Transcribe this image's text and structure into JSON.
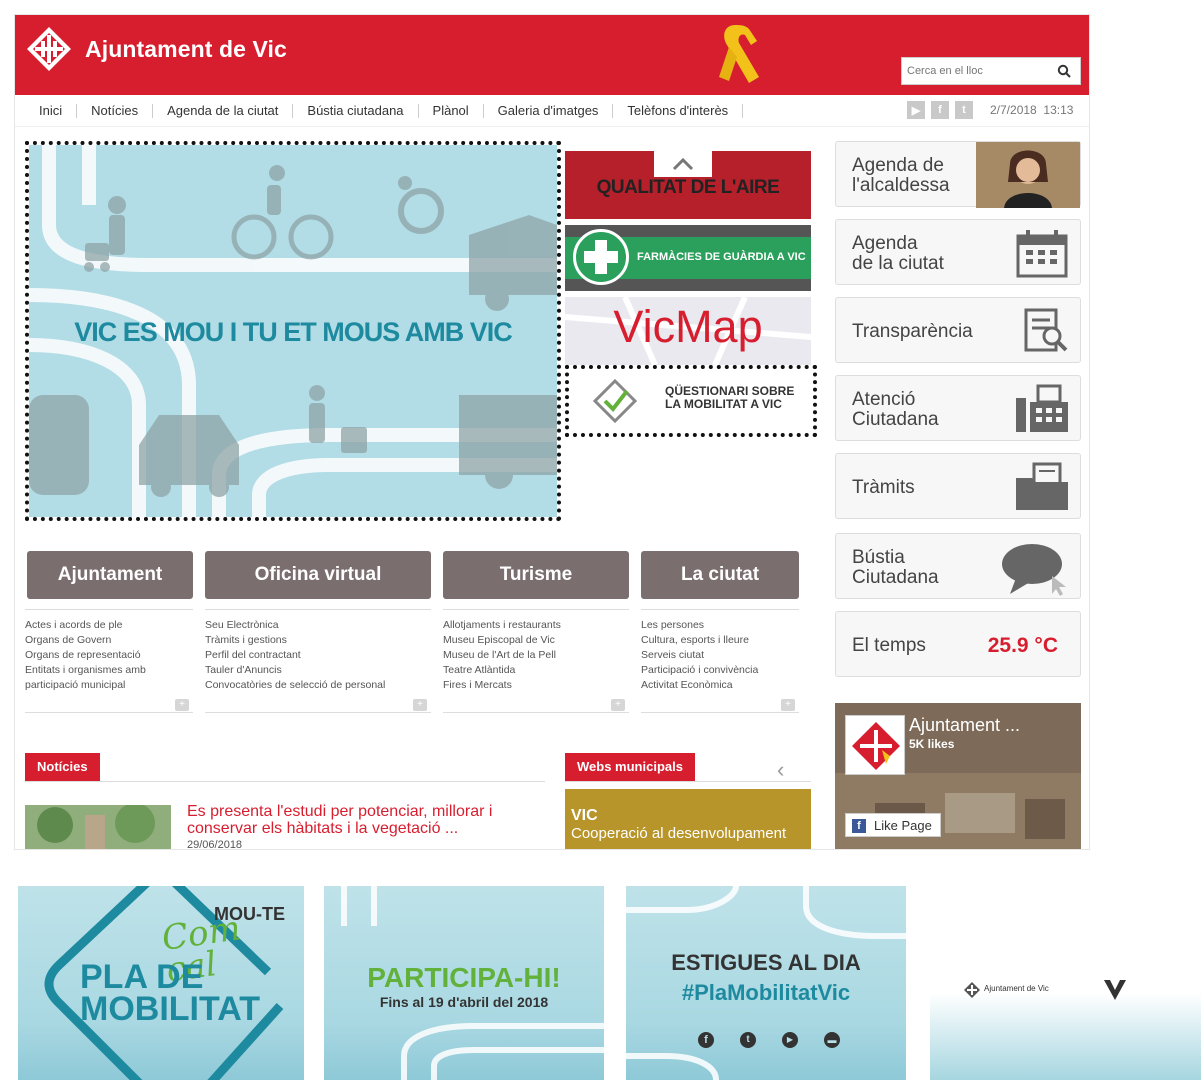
{
  "header": {
    "site_title": "Ajuntament de Vic",
    "search_placeholder": "Cerca en el lloc"
  },
  "nav": {
    "items": [
      "Inici",
      "Notícies",
      "Agenda de la ciutat",
      "Bústia ciutadana",
      "Plànol",
      "Galeria d'imatges",
      "Telèfons d'interès"
    ],
    "date": "2/7/2018",
    "time": "13:13"
  },
  "hero": {
    "title": "VIC ES MOU I TU ET MOUS AMB VIC"
  },
  "tiles": {
    "aire": "QUALITAT DE L'AIRE",
    "farmacies": "FARMÀCIES DE GUÀRDIA A VIC",
    "vicmap": "VicMap",
    "questionari_line1": "QÜESTIONARI SOBRE",
    "questionari_line2": "LA MOBILITAT A VIC"
  },
  "right_column": {
    "alcaldessa_line1": "Agenda de",
    "alcaldessa_line2": "l'alcaldessa",
    "agenda_line1": "Agenda",
    "agenda_line2": "de la ciutat",
    "transparencia": "Transparència",
    "atencio_line1": "Atenció",
    "atencio_line2": "Ciutadana",
    "tramits": "Tràmits",
    "bustia_line1": "Bústia",
    "bustia_line2": "Ciutadana",
    "temps_label": "El temps",
    "temps_value": "25.9 °C"
  },
  "sections": {
    "ajuntament": {
      "label": "Ajuntament",
      "links": [
        "Actes i acords de ple",
        "Organs de Govern",
        "Organs de representació",
        "Entitats i organismes amb",
        "participació municipal"
      ]
    },
    "oficina": {
      "label": "Oficina virtual",
      "links": [
        "Seu Electrònica",
        "Tràmits i gestions",
        "Perfil del contractant",
        "Tauler d'Anuncis",
        "Convocatòries de selecció de personal"
      ]
    },
    "turisme": {
      "label": "Turisme",
      "links": [
        "Allotjaments i restaurants",
        "Museu Episcopal de Vic",
        "Museu de l'Art de la Pell",
        "Teatre Atlàntida",
        "Fires i Mercats"
      ]
    },
    "ciutat": {
      "label": "La ciutat",
      "links": [
        "Les persones",
        "Cultura, esports i lleure",
        "Serveis ciutat",
        "Participació i convivència",
        "Activitat Econòmica"
      ]
    }
  },
  "news": {
    "header": "Notícies",
    "title": "Es presenta l'estudi per potenciar, millorar i conservar els hàbitats i la vegetació ...",
    "date": "29/06/2018"
  },
  "webs": {
    "header": "Webs municipals",
    "banner_line1": "VIC",
    "banner_line2": "Cooperació al desenvolupament"
  },
  "facebook": {
    "name": "Ajuntament ...",
    "likes": "5K likes",
    "like_button": "Like Page"
  },
  "promos": {
    "p1_top": "MOU-TE",
    "p1_script": "Com cal",
    "p1_line1": "PLA DE",
    "p1_line2": "MOBILITAT",
    "p2_title": "PARTICIPA-HI!",
    "p2_sub": "Fins al 19 d'abril del 2018",
    "p3_line1": "ESTIGUES AL DIA",
    "p3_line2": "#PlaMobilitatVic",
    "p4_logo": "Ajuntament de Vic"
  },
  "colors": {
    "brand_red": "#d71e2f",
    "hero_bg": "#b2dde6",
    "hero_text": "#1e8a9f",
    "section_tab": "#7b6e6e",
    "promo_green": "#62b13b"
  }
}
